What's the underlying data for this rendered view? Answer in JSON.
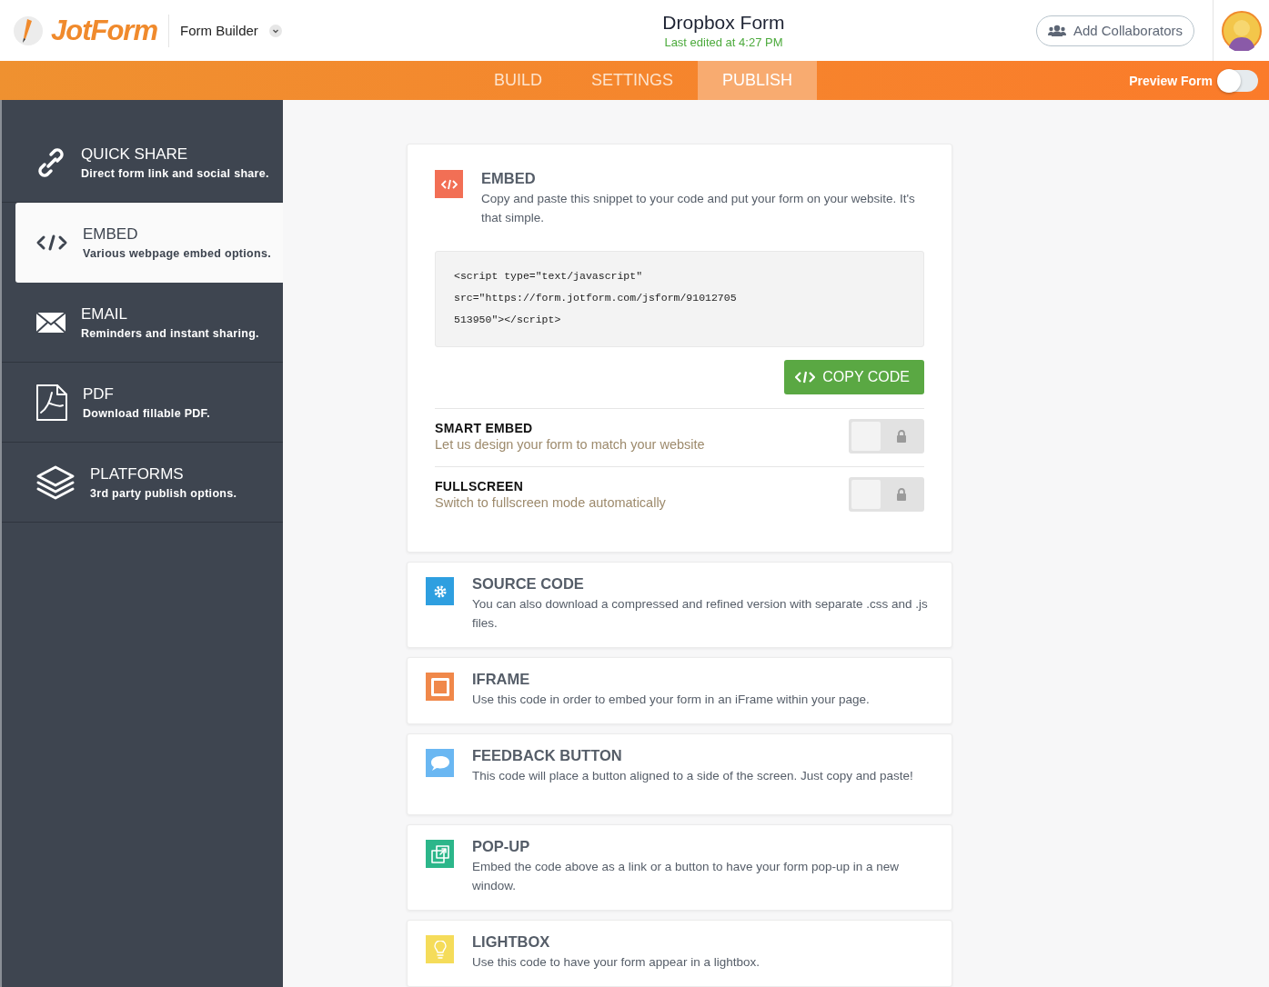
{
  "header": {
    "logo": "JotForm",
    "app_menu": "Form Builder",
    "form_title": "Dropbox Form",
    "last_edited": "Last edited at 4:27 PM",
    "collaborators_button": "Add Collaborators"
  },
  "tabs": [
    {
      "label": "BUILD",
      "selected": false
    },
    {
      "label": "SETTINGS",
      "selected": false
    },
    {
      "label": "PUBLISH",
      "selected": true
    }
  ],
  "preview": {
    "label": "Preview Form",
    "on": false
  },
  "sidebar": {
    "items": [
      {
        "kind": "link",
        "title": "QUICK SHARE",
        "subtitle": "Direct form link and social share.",
        "selected": false
      },
      {
        "kind": "code",
        "title": "EMBED",
        "subtitle": "Various webpage embed options.",
        "selected": true
      },
      {
        "kind": "mail",
        "title": "EMAIL",
        "subtitle": "Reminders and instant sharing.",
        "selected": false
      },
      {
        "kind": "pdf",
        "title": "PDF",
        "subtitle": "Download fillable PDF.",
        "selected": false
      },
      {
        "kind": "layers",
        "title": "PLATFORMS",
        "subtitle": "3rd party publish options.",
        "selected": false
      }
    ]
  },
  "embed": {
    "title": "EMBED",
    "description": "Copy and paste this snippet to your code and put your form on your website. It's that simple.",
    "color": "#f26f55",
    "code_lines": [
      "<script type=\"text/javascript\"",
      "src=\"https://form.jotform.com/jsform/91012705",
      "513950\"></script>"
    ],
    "copy_button": "COPY CODE",
    "options": [
      {
        "title": "SMART EMBED",
        "description": "Let us design your form to match your website",
        "on": false,
        "locked": true
      },
      {
        "title": "FULLSCREEN",
        "description": "Switch to fullscreen mode automatically",
        "on": false,
        "locked": true
      }
    ]
  },
  "methods": [
    {
      "kind": "gear",
      "color": "#2e9fe0",
      "title": "SOURCE CODE",
      "description": "You can also download a compressed and refined version with separate .css and .js files."
    },
    {
      "kind": "frame",
      "color": "#f0884a",
      "title": "IFRAME",
      "description": "Use this code in order to embed your form in an iFrame within your page."
    },
    {
      "kind": "chat",
      "color": "#6ab7f2",
      "title": "FEEDBACK BUTTON",
      "description": "This code will place a button aligned to a side of the screen. Just copy and paste!"
    },
    {
      "kind": "popup",
      "color": "#2cb68a",
      "title": "POP-UP",
      "description": "Embed the code above as a link or a button to have your form pop-up in a new window."
    },
    {
      "kind": "bulb",
      "color": "#f5dc5a",
      "title": "LIGHTBOX",
      "description": "Use this code to have your form appear in a lightbox."
    }
  ]
}
